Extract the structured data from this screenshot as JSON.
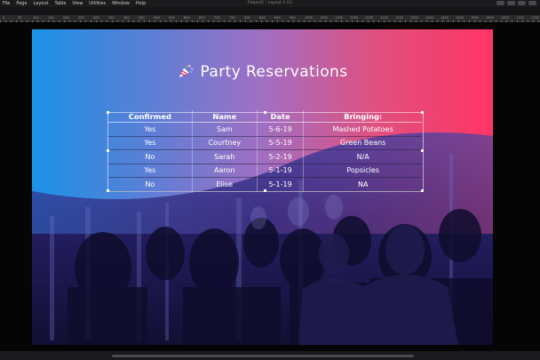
{
  "menubar": {
    "items": [
      "File",
      "Page",
      "Layout",
      "Table",
      "View",
      "Utilities",
      "Window",
      "Help"
    ],
    "document_title": "Project1 : Layout 1 (1)"
  },
  "ruler": {
    "labels": [
      "0",
      "50",
      "100",
      "150",
      "200",
      "250",
      "300",
      "350",
      "400",
      "450",
      "500",
      "550",
      "600",
      "650",
      "700",
      "750",
      "800",
      "850",
      "900",
      "950",
      "1000",
      "1050",
      "1100",
      "1150",
      "1200",
      "1250",
      "1300",
      "1350",
      "1400",
      "1450",
      "1500",
      "1550",
      "1600",
      "1650",
      "1700",
      "1750"
    ]
  },
  "page": {
    "title": "Party Reservations",
    "title_icon": "party-popper-icon",
    "colors": {
      "gradient_left": "#1a92e6",
      "gradient_right": "#ff3565",
      "crowd_tint": "#2a2470"
    }
  },
  "table": {
    "headers": [
      "Confirmed",
      "Name",
      "Date",
      "Bringing:"
    ],
    "rows": [
      [
        "Yes",
        "Sam",
        "5-6-19",
        "Mashed Potatoes"
      ],
      [
        "Yes",
        "Courtney",
        "5-5-19",
        "Green Beans"
      ],
      [
        "No",
        "Sarah",
        "5-2-19",
        "N/A"
      ],
      [
        "Yes",
        "Aaron",
        "5-1-19",
        "Popsicles"
      ],
      [
        "No",
        "Elise",
        "5-1-19",
        "NA"
      ]
    ]
  }
}
